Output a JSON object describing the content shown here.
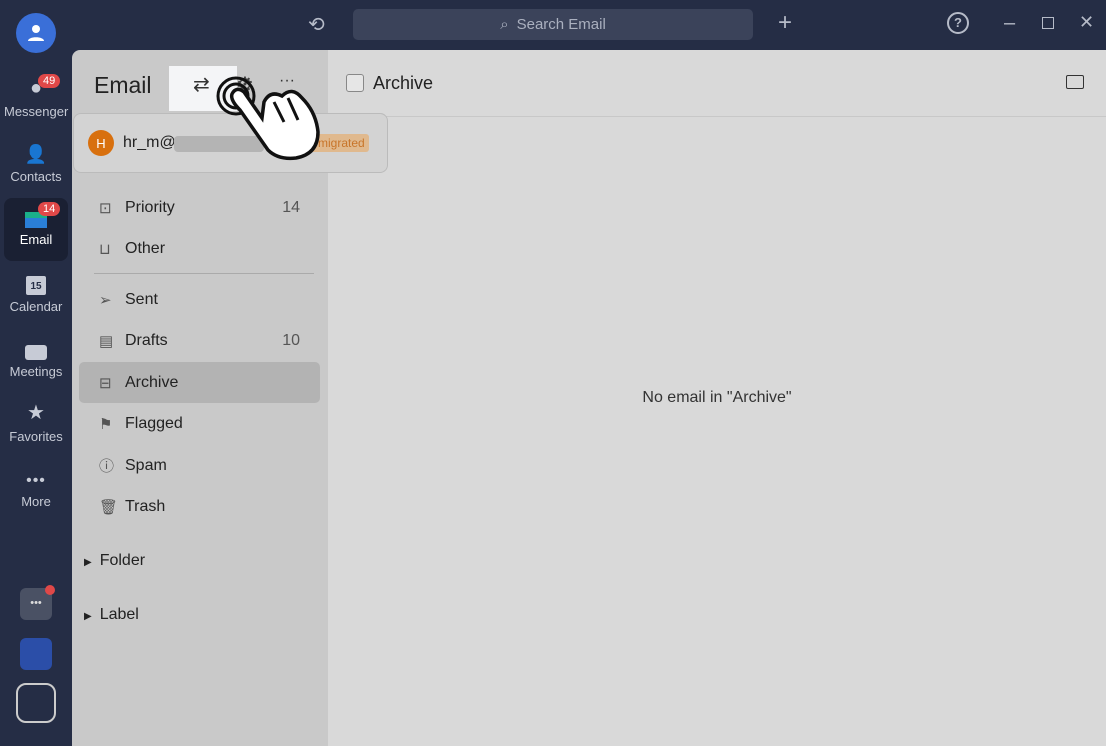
{
  "rail": {
    "items": [
      {
        "label": "Messenger",
        "badge": "49",
        "icon": "chat-icon"
      },
      {
        "label": "Contacts",
        "icon": "contacts-icon"
      },
      {
        "label": "Email",
        "badge": "14",
        "icon": "email-icon"
      },
      {
        "label": "Calendar",
        "icon": "calendar-icon",
        "day": "15"
      },
      {
        "label": "Meetings",
        "icon": "video-icon"
      },
      {
        "label": "Favorites",
        "icon": "star-icon"
      },
      {
        "label": "More",
        "icon": "more-icon"
      }
    ]
  },
  "topbar": {
    "search_placeholder": "Search Email"
  },
  "email": {
    "title": "Email",
    "account": "hr_m@",
    "account_initial": "H",
    "account_tag": "e migrated"
  },
  "folders": [
    {
      "label": "Priority",
      "count": "14",
      "icon": "⊡"
    },
    {
      "label": "Other",
      "count": "",
      "icon": "⊔"
    },
    {
      "label": "Sent",
      "count": "",
      "icon": "➢"
    },
    {
      "label": "Drafts",
      "count": "10",
      "icon": "▤"
    },
    {
      "label": "Archive",
      "count": "",
      "icon": "⊟"
    },
    {
      "label": "Flagged",
      "count": "",
      "icon": "⚑"
    },
    {
      "label": "Spam",
      "count": "",
      "icon": "ⓘ"
    },
    {
      "label": "Trash",
      "count": "",
      "icon": "🗑"
    }
  ],
  "groups": [
    "Folder",
    "Label"
  ],
  "main": {
    "header": "Archive",
    "empty": "No email in \"Archive\""
  }
}
